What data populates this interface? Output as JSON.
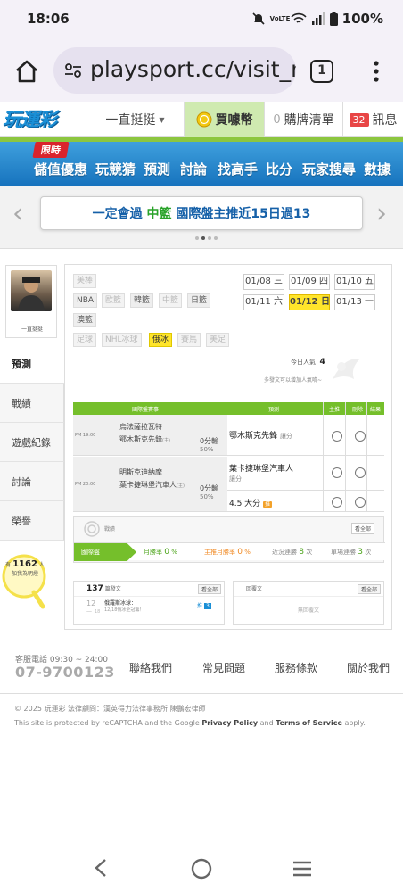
{
  "status": {
    "time": "18:06",
    "battery": "100%",
    "volte": "VoLTE"
  },
  "browser": {
    "url": "playsport.cc/visit_m",
    "tab_count": "1"
  },
  "header": {
    "logo": "玩運彩",
    "user": "一直挺挺",
    "coin": "買噱幣",
    "buy_count": "0",
    "buy_list": "購牌清單",
    "msg_count": "32",
    "msg": "訊息"
  },
  "nav": {
    "limited": "限時",
    "items": [
      "儲值優惠",
      "玩競猜",
      "預測",
      "討論",
      "找高手",
      "比分",
      "玩家搜尋",
      "數據"
    ]
  },
  "marquee": {
    "prefix": "一定會過",
    "league": "中籃",
    "text": "國際盤主推近15日過13"
  },
  "sidebar": {
    "username": "一直挺挺",
    "items": [
      "預測",
      "戰績",
      "遊戲紀錄",
      "討論",
      "榮譽"
    ],
    "helpers_prefix": "有",
    "helpers_count": "1162",
    "helpers_unit": "人",
    "helpers_suffix": "加我為明燈"
  },
  "sports": [
    "美棒",
    "NBA",
    "歐籃",
    "韓籃",
    "中籃",
    "日籃",
    "澳籃",
    "足球",
    "NHL冰球",
    "俄冰",
    "賽馬",
    "美足"
  ],
  "dates": [
    "01/08 三",
    "01/09 四",
    "01/10 五",
    "01/11 六",
    "01/12 日",
    "01/13 一"
  ],
  "today": {
    "label": "今日人氣",
    "count": "4",
    "note": "多發文可以增加人氣唷~"
  },
  "table": {
    "headers": [
      "國際盤賽事",
      "預測",
      "主推",
      "刪除",
      "結果"
    ],
    "rows": [
      {
        "time": "PM 19:00",
        "team1": "烏法薩拉瓦特",
        "team2": "鄂木斯克先鋒",
        "team2_tag": "(主)",
        "line": "0分輸",
        "pct": "50%",
        "pick": "鄂木斯克先鋒",
        "pick_unit": "讓分"
      },
      {
        "time": "PM 20:00",
        "team1": "明斯克迪納摩",
        "team2": "葉卡捷琳堡汽車人",
        "team2_tag": "(主)",
        "line": "0分輸",
        "pct": "50%",
        "pick": "葉卡捷琳堡汽車人",
        "pick_unit": "讓分"
      },
      {
        "pick": "4.5 大分",
        "pick_badge": "推"
      }
    ]
  },
  "stats": {
    "title": "戰績",
    "all": "看全部",
    "tag": "國際盤",
    "items": [
      {
        "label": "月勝率",
        "value": "0",
        "unit": "%"
      },
      {
        "label": "主推月勝率",
        "value": "0",
        "unit": "%"
      },
      {
        "label": "近況連勝",
        "value": "8",
        "unit": "次"
      },
      {
        "label": "單場連勝",
        "value": "3",
        "unit": "次"
      }
    ]
  },
  "posts": {
    "count": "137",
    "label": "篇發文",
    "all": "看全部",
    "date_day": "12",
    "date_month": "一",
    "date_year": "18",
    "post_title": "俄羅斯冰球：",
    "post_sub": "12/18俄冰全冠籌！",
    "post_badge": "3",
    "post_badge_prefix": "推",
    "reply_label": "回覆文",
    "reply_all": "看全部",
    "reply_empty": "無回覆文"
  },
  "footer": {
    "service_label": "客服電話 09:30 ~ 24:00",
    "phone": "07-9700123",
    "links": [
      "聯絡我們",
      "常見問題",
      "服務條款",
      "關於我們"
    ],
    "copyright": "© 2025 玩運彩 法律顧問：漢英得力法律事務所 陳鵬宏律師",
    "recaptcha_pre": "This site is protected by reCAPTCHA and the Google ",
    "privacy": "Privacy Policy",
    "and": " and ",
    "terms": "Terms of Service",
    "apply": " apply."
  },
  "colors": {
    "green": "#75bf2b",
    "blue": "#1a8fd6",
    "yellow": "#ffe52b",
    "red": "#e84545"
  }
}
